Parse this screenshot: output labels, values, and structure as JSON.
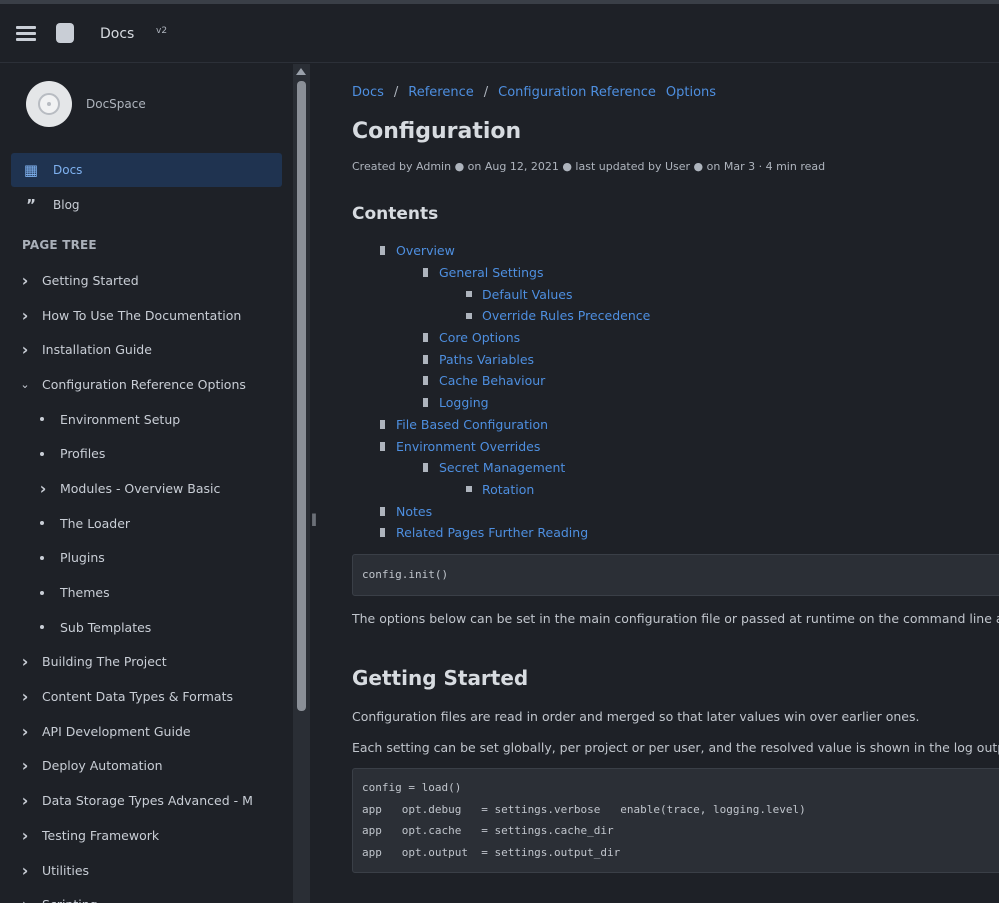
{
  "topbar": {
    "app_title": "Docs",
    "app_title_suffix": "v2"
  },
  "sidebar": {
    "brand_name": "DocSpace",
    "nav": [
      {
        "label": "Docs",
        "icon": "book-icon",
        "active": true
      },
      {
        "label": "Blog",
        "icon": "quote-icon",
        "active": false
      }
    ],
    "tree_heading": "PAGE TREE",
    "tree": [
      {
        "label": "Getting Started",
        "expanded": false,
        "child": false,
        "has_children": true
      },
      {
        "label": "How To Use The Documentation",
        "expanded": false,
        "child": false,
        "has_children": true
      },
      {
        "label": "Installation Guide",
        "expanded": false,
        "child": false,
        "has_children": true
      },
      {
        "label": "Configuration Reference Options",
        "expanded": true,
        "child": false,
        "has_children": true
      },
      {
        "label": "Environment Setup",
        "child": true,
        "has_children": false
      },
      {
        "label": "Profiles",
        "child": true,
        "has_children": false
      },
      {
        "label": "Modules - Overview Basic",
        "child": true,
        "has_children": true
      },
      {
        "label": "The Loader",
        "child": true,
        "has_children": false
      },
      {
        "label": "Plugins",
        "child": true,
        "has_children": false
      },
      {
        "label": "Themes",
        "child": true,
        "has_children": false
      },
      {
        "label": "Sub Templates",
        "child": true,
        "has_children": false
      },
      {
        "label": "Building The Project",
        "expanded": false,
        "child": false,
        "has_children": true
      },
      {
        "label": "Content Data Types & Formats",
        "expanded": false,
        "child": false,
        "has_children": true
      },
      {
        "label": "API Development Guide",
        "expanded": false,
        "child": false,
        "has_children": true
      },
      {
        "label": "Deploy Automation",
        "expanded": false,
        "child": false,
        "has_children": true
      },
      {
        "label": "Data Storage Types Advanced - M",
        "expanded": false,
        "child": false,
        "has_children": true
      },
      {
        "label": "Testing Framework",
        "expanded": false,
        "child": false,
        "has_children": true
      },
      {
        "label": "Utilities",
        "expanded": false,
        "child": false,
        "has_children": true
      },
      {
        "label": "Scripting",
        "expanded": false,
        "child": false,
        "has_children": true
      }
    ]
  },
  "main": {
    "breadcrumbs": [
      "Docs",
      "Reference",
      "Configuration Reference",
      "Options"
    ],
    "title": "Configuration",
    "meta": "Created by Admin ● on Aug 12, 2021 ● last updated by User ● on Mar 3 · 4 min read",
    "toc_title": "Contents",
    "toc": [
      {
        "level": 0,
        "label": "Overview"
      },
      {
        "level": 1,
        "label": "General Settings"
      },
      {
        "level": 2,
        "label": "Default Values"
      },
      {
        "level": 2,
        "label": "Override Rules Precedence"
      },
      {
        "level": 1,
        "label": "Core Options"
      },
      {
        "level": 1,
        "label": "Paths Variables"
      },
      {
        "level": 1,
        "label": "Cache Behaviour"
      },
      {
        "level": 1,
        "label": "Logging"
      },
      {
        "level": 0,
        "label": "File Based Configuration"
      },
      {
        "level": 0,
        "label": "Environment Overrides"
      },
      {
        "level": 1,
        "label": "Secret Management"
      },
      {
        "level": 2,
        "label": "Rotation"
      },
      {
        "level": 0,
        "label": "Notes"
      },
      {
        "level": 0,
        "label": "Related Pages Further Reading"
      }
    ],
    "code1": "config.init()",
    "para1": "The options below can be set in the main configuration file or passed at runtime on the command line as flags.",
    "h2": "Getting Started",
    "para2": "Configuration files are read in order and merged so that later values win over earlier ones.",
    "para3": "Each setting can be set globally, per project or per user, and the resolved value is shown in the log output.",
    "code2": [
      "config = load()",
      "app   opt.debug   = settings.verbose   enable(trace, logging.level)",
      "app   opt.cache   = settings.cache_dir",
      "app   opt.output  = settings.output_dir"
    ]
  }
}
